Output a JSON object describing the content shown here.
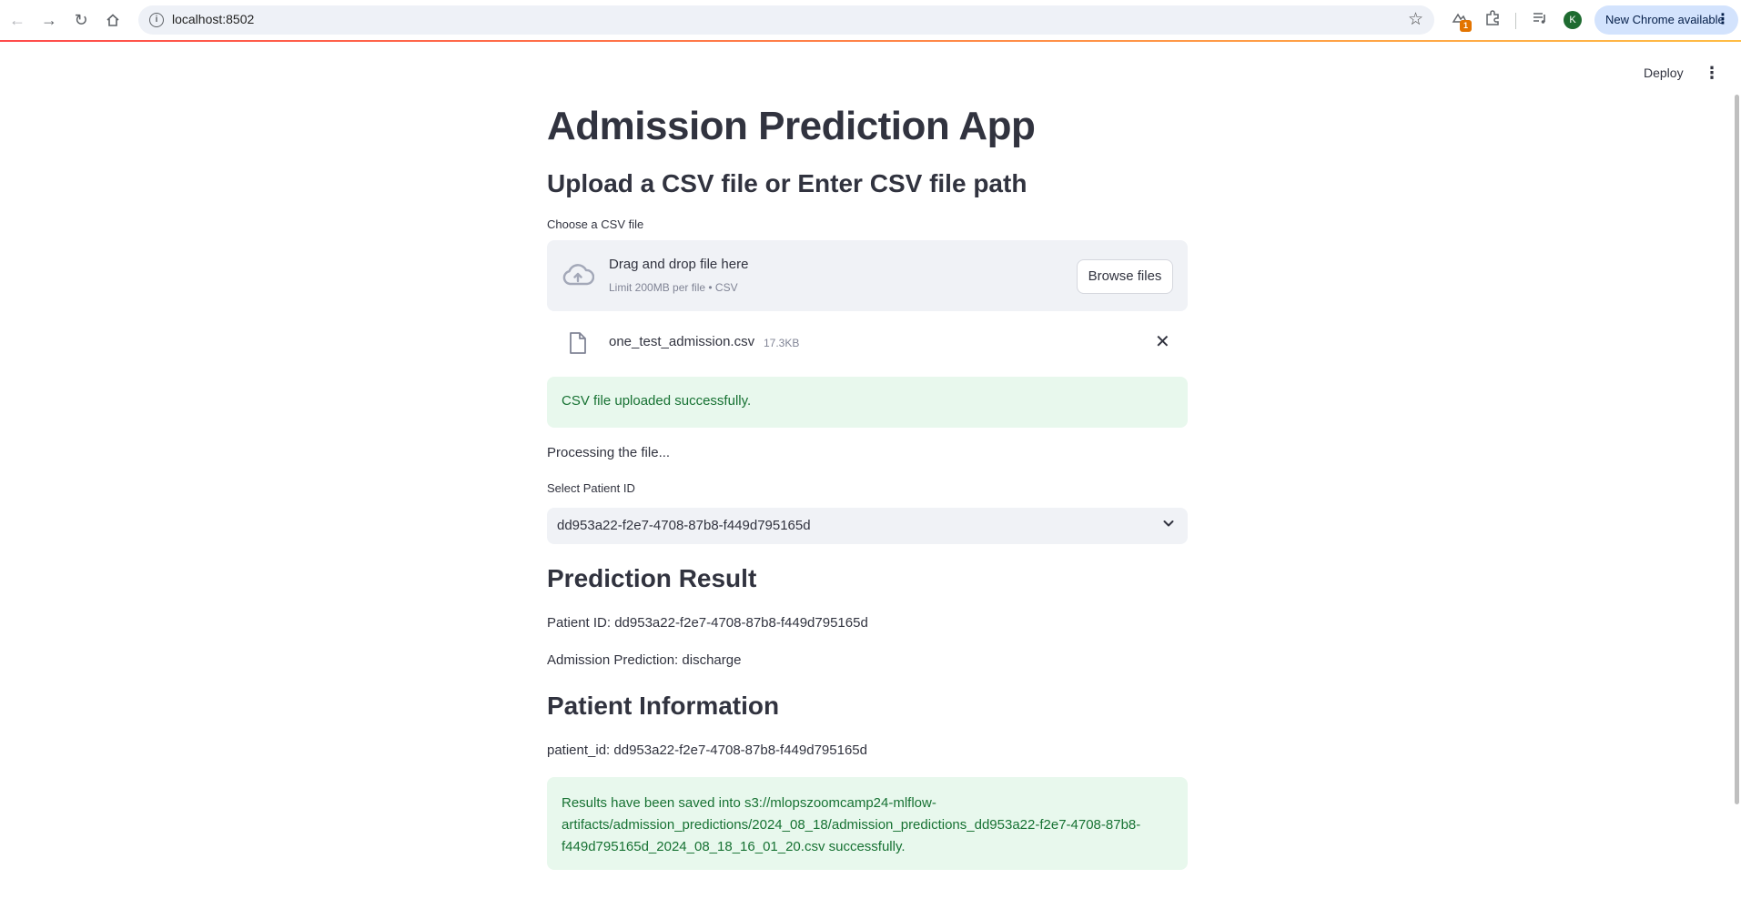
{
  "browser": {
    "url": "localhost:8502",
    "update_label": "New Chrome available",
    "profile_initial": "K",
    "extension_badge": "1"
  },
  "header": {
    "deploy_label": "Deploy"
  },
  "page": {
    "title": "Admission Prediction App",
    "upload_heading": "Upload a CSV file or Enter CSV file path",
    "uploader_label": "Choose a CSV file",
    "dropzone_title": "Drag and drop file here",
    "dropzone_limit": "Limit 200MB per file • CSV",
    "browse_label": "Browse files",
    "uploaded_file": {
      "name": "one_test_admission.csv",
      "size": "17.3KB"
    },
    "upload_success": "CSV file uploaded successfully.",
    "processing_text": "Processing the file...",
    "select_label": "Select Patient ID",
    "selected_patient": "dd953a22-f2e7-4708-87b8-f449d795165d",
    "prediction_heading": "Prediction Result",
    "patient_id_line": "Patient ID: dd953a22-f2e7-4708-87b8-f449d795165d",
    "prediction_line": "Admission Prediction: discharge",
    "info_heading": "Patient Information",
    "patient_info_line": "patient_id: dd953a22-f2e7-4708-87b8-f449d795165d",
    "saved_message": "Results have been saved into s3://mlopszoomcamp24-mlflow-artifacts/admission_predictions/2024_08_18/admission_predictions_dd953a22-f2e7-4708-87b8-f449d795165d_2024_08_18_16_01_20.csv successfully."
  },
  "colors": {
    "success_bg": "#e8f8ed",
    "success_text": "#177233",
    "widget_bg": "#f0f2f6",
    "accent_gradient_start": "#ff4b4b",
    "accent_gradient_end": "#ffbd45"
  }
}
